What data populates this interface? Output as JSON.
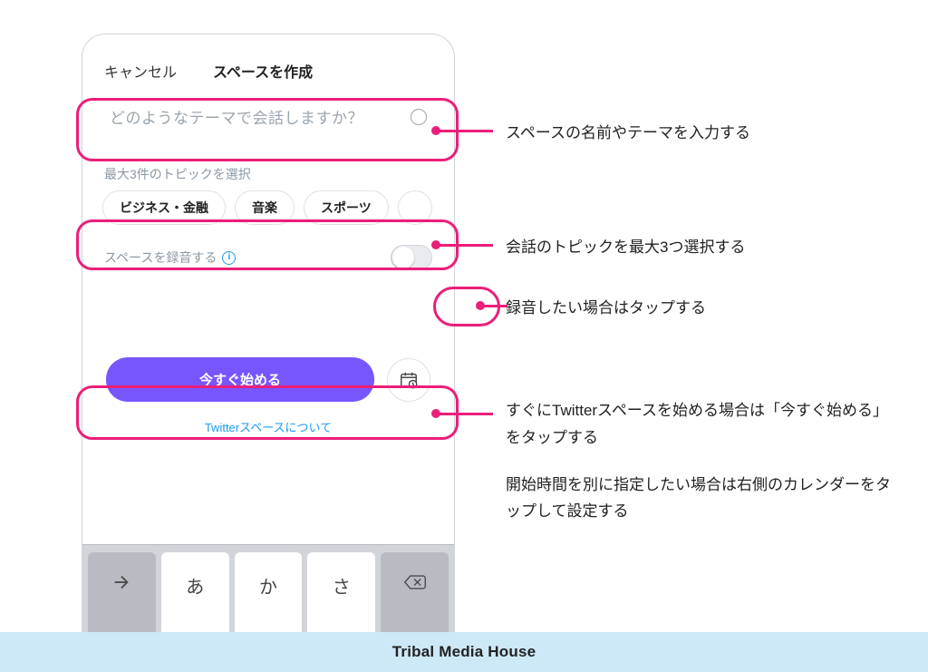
{
  "phone": {
    "cancel": "キャンセル",
    "title": "スペースを作成",
    "input_placeholder": "どのようなテーマで会話しますか？",
    "topic_section_label": "最大3件のトピックを選択",
    "chips": [
      "ビジネス・金融",
      "音楽",
      "スポーツ"
    ],
    "record_label": "スペースを録音する",
    "start_label": "今すぐ始める",
    "about_link": "Twitterスペースについて"
  },
  "keys": {
    "k1": "あ",
    "k2": "か",
    "k3": "さ"
  },
  "callouts": {
    "c1": "スペースの名前やテーマを入力する",
    "c2": "会話のトピックを最大3つ選択する",
    "c3": "録音したい場合はタップする",
    "c4a": "すぐにTwitterスペースを始める場合は「今すぐ始める」をタップする",
    "c4b": "開始時間を別に指定したい場合は右側のカレンダーをタップして設定する"
  },
  "footer": "Tribal Media House",
  "colors": {
    "accent": "#EB1E79",
    "purple": "#7856FF",
    "twitter_blue": "#1D9BF0"
  }
}
